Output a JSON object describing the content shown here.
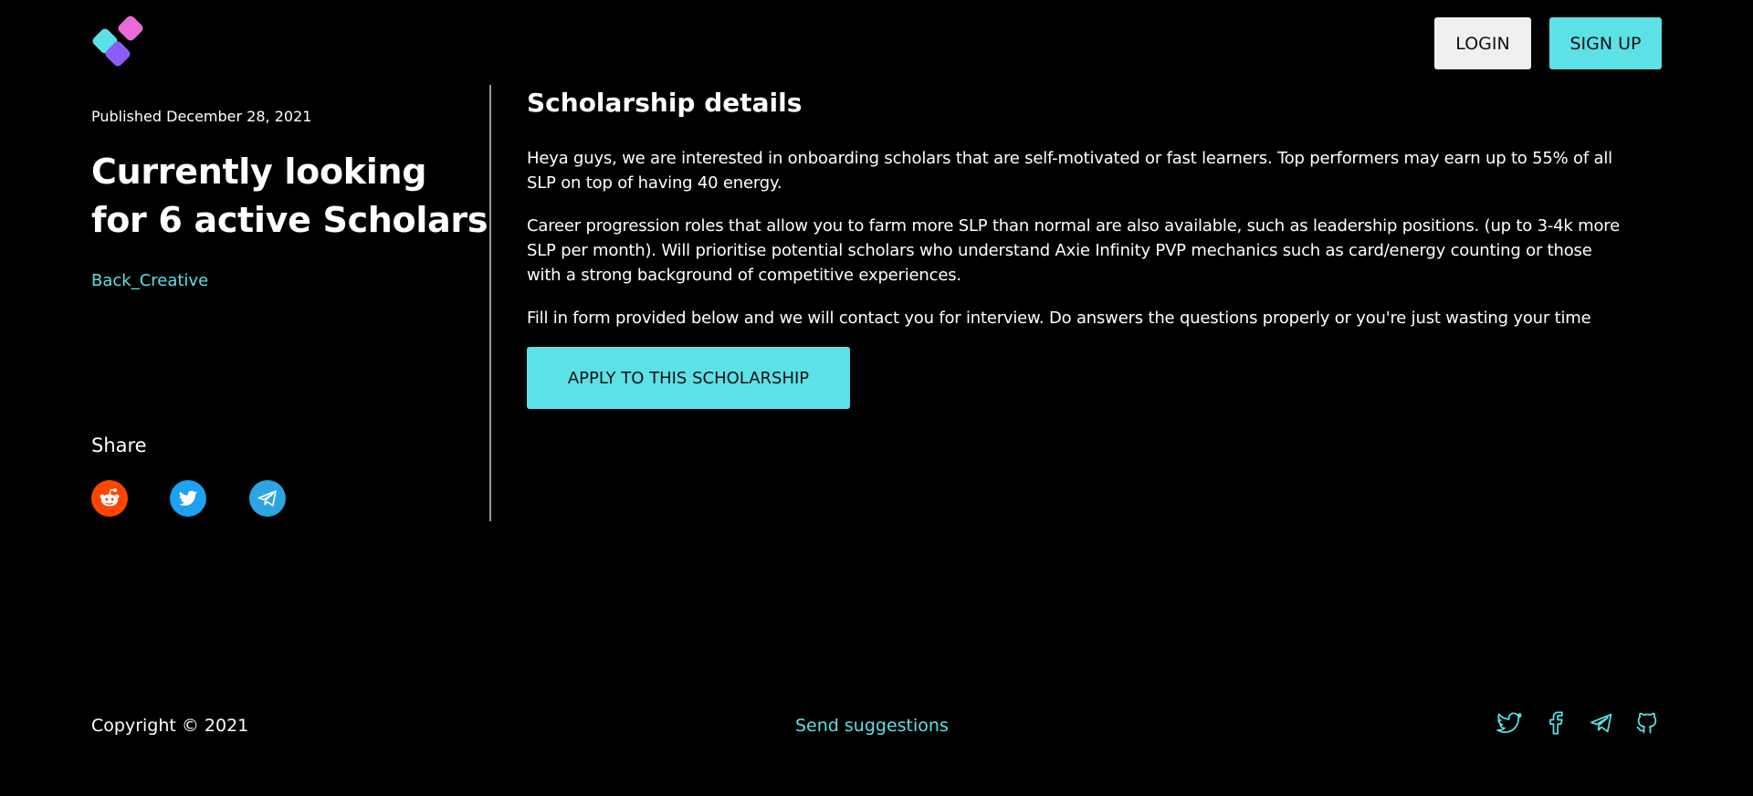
{
  "colors": {
    "background": "#000000",
    "accent": "#5ce1e6",
    "login_bg": "#f0f0f0",
    "reddit": "#ff4500",
    "twitter": "#1da1f2",
    "telegram": "#2ca5e0"
  },
  "header": {
    "logo_icon": "diamond-blocks-logo",
    "login_label": "LOGIN",
    "signup_label": "SIGN UP"
  },
  "post": {
    "published": "Published December 28, 2021",
    "title": "Currently looking for 6 active Scholars",
    "author": "Back_Creative"
  },
  "share": {
    "label": "Share",
    "icons": [
      "reddit-icon",
      "twitter-icon",
      "telegram-icon"
    ]
  },
  "details": {
    "heading": "Scholarship details",
    "paragraphs": [
      "Heya guys, we are interested in onboarding scholars that are self-motivated or fast learners. Top performers may earn up to 55% of all SLP on top of having 40 energy.",
      "Career progression roles that allow you to farm more SLP than normal are also available, such as leadership positions. (up to 3-4k more SLP per month). Will prioritise potential scholars who understand Axie Infinity PVP mechanics such as card/energy counting or those with a strong background of competitive experiences.",
      "Fill in form provided below and we will contact you for interview. Do answers the questions properly or you're just wasting your time"
    ],
    "apply_label": "APPLY TO THIS SCHOLARSHIP"
  },
  "footer": {
    "copyright": "Copyright © 2021",
    "suggestions": "Send suggestions",
    "icons": [
      "twitter-icon",
      "facebook-icon",
      "telegram-icon",
      "github-icon"
    ]
  }
}
